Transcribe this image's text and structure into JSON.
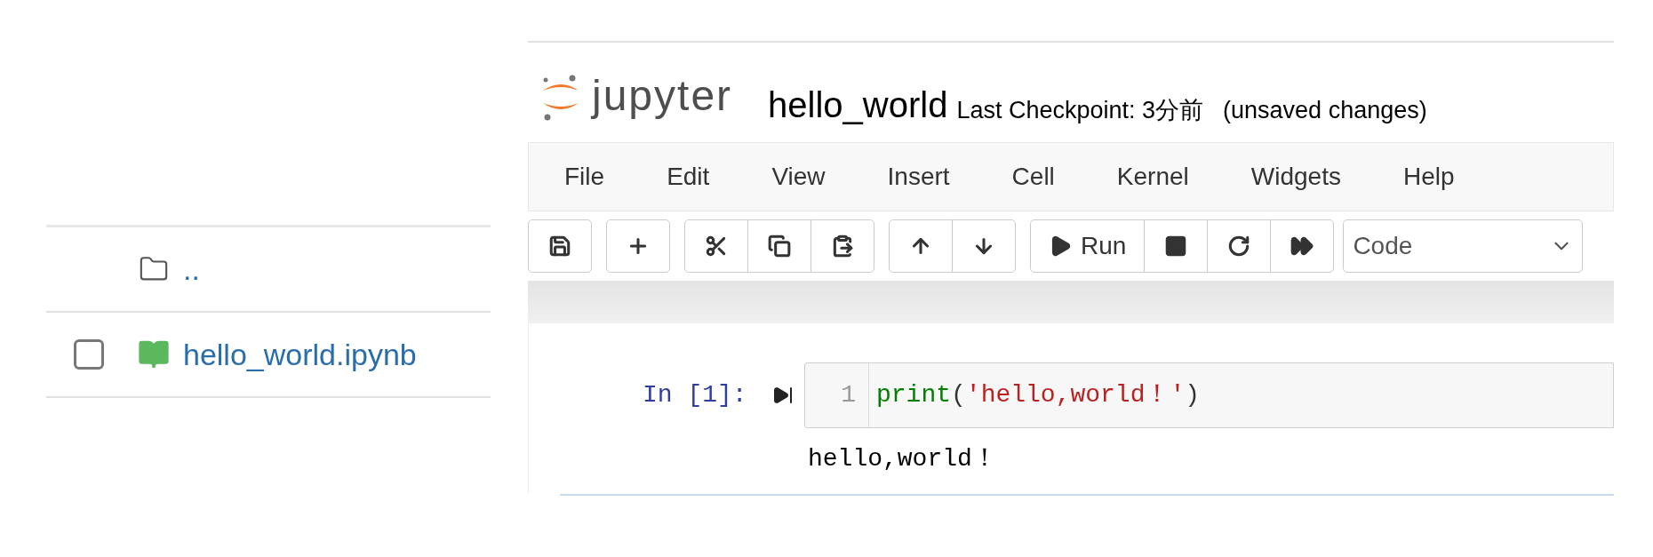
{
  "file_list": {
    "rows": [
      {
        "kind": "folder",
        "name": "..",
        "checked": null
      },
      {
        "kind": "notebook",
        "name": "hello_world.ipynb",
        "checked": false
      }
    ]
  },
  "notebook": {
    "logo_text": "jupyter",
    "title": "hello_world",
    "checkpoint": "Last Checkpoint: 3分前",
    "status": "(unsaved changes)",
    "menu": [
      "File",
      "Edit",
      "View",
      "Insert",
      "Cell",
      "Kernel",
      "Widgets",
      "Help"
    ],
    "toolbar": [
      [
        {
          "kind": "save"
        }
      ],
      [
        {
          "kind": "insert"
        }
      ],
      [
        {
          "kind": "cut"
        },
        {
          "kind": "copy"
        },
        {
          "kind": "paste"
        }
      ],
      [
        {
          "kind": "move-up"
        },
        {
          "kind": "move-down"
        }
      ],
      [
        {
          "kind": "run",
          "label": "Run"
        },
        {
          "kind": "interrupt"
        },
        {
          "kind": "restart"
        },
        {
          "kind": "run-all"
        }
      ]
    ],
    "cell_type": "Code",
    "cell": {
      "prompt": "In [1]:",
      "line_number": "1",
      "code": [
        {
          "kind": "builtin",
          "text": "print"
        },
        {
          "kind": "punct",
          "text": "("
        },
        {
          "kind": "string",
          "text": "'hello,world！'"
        },
        {
          "kind": "punct",
          "text": ")"
        }
      ],
      "output": "hello,world！"
    }
  }
}
